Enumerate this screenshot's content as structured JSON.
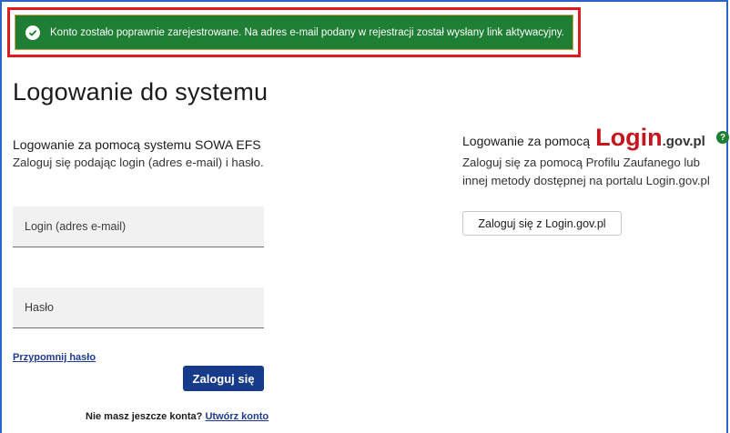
{
  "alert": {
    "message": "Konto zostało poprawnie zarejestrowane. Na adres e-mail podany w rejestracji został wysłany link aktywacyjny.",
    "icon": "check-circle-icon",
    "color": "#1e7e34"
  },
  "page": {
    "title": "Logowanie do systemu"
  },
  "sowa": {
    "title": "Logowanie za pomocą systemu SOWA EFS",
    "description": "Zaloguj się podając login (adres e-mail) i hasło.",
    "login_placeholder": "Login (adres e-mail)",
    "password_placeholder": "Hasło",
    "forgot_password": "Przypomnij hasło",
    "submit_label": "Zaloguj się",
    "no_account_text": "Nie masz jeszcze konta?",
    "create_account": "Utwórz konto"
  },
  "logingov": {
    "title_prefix": "Logowanie za pomocą",
    "logo_main": "Login",
    "logo_suffix": ".gov.pl",
    "description_line1": "Zaloguj się za pomocą Profilu Zaufanego lub",
    "description_line2": "innej metody dostępnej na portalu Login.gov.pl",
    "button_label": "Zaloguj się z Login.gov.pl",
    "help_icon": "question-circle-icon",
    "help_glyph": "?"
  },
  "colors": {
    "primary": "#163b8a",
    "accent_red": "#c4161c",
    "success": "#1e7e34"
  }
}
